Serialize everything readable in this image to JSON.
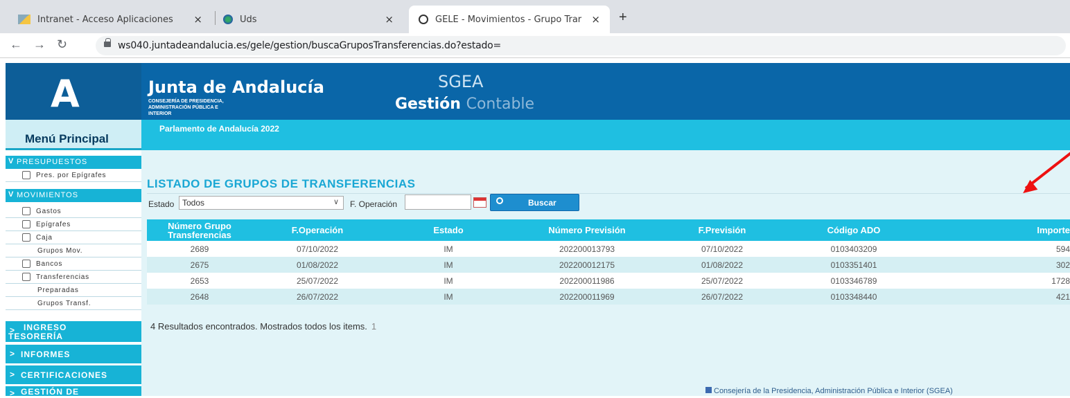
{
  "browser": {
    "tabs": [
      {
        "title": "Intranet - Acceso Aplicaciones",
        "close": "×"
      },
      {
        "title": "Uds",
        "close": "×"
      },
      {
        "title": "GELE - Movimientos - Grupo Trar",
        "close": "×"
      }
    ],
    "new_tab": "+",
    "url": "ws040.juntadeandalucia.es/gele/gestion/buscaGruposTransferencias.do?estado="
  },
  "header": {
    "logo_letter": "A",
    "org": "Junta de Andalucía",
    "consejeria": "CONSEJERÍA DE PRESIDENCIA, ADMINISTRACIÓN PÚBLICA E INTERIOR",
    "app": "SGEA",
    "subtitle_a": "Gestión",
    "subtitle_b": "Contable"
  },
  "menu": {
    "title": "Menú Principal",
    "presupuestos": "PRESUPUESTOS",
    "pres_epigrafes": "Pres. por Epígrafes",
    "movimientos": "MOVIMIENTOS",
    "gastos": "Gastos",
    "epigrafes": "Epígrafes",
    "caja": "Caja",
    "grupos_mov": "Grupos Mov.",
    "bancos": "Bancos",
    "transferencias": "Transferencias",
    "preparadas": "Preparadas",
    "grupos_transf": "Grupos Transf.",
    "ingreso": "INGRESO",
    "tesoreria": "TESORERÍA",
    "informes": "INFORMES",
    "certificaciones": "CERTIFICACIONES",
    "gestion_de": "GESTIÓN DE"
  },
  "context": "Parlamento de Andalucía 2022",
  "page_title": "LISTADO DE GRUPOS DE TRANSFERENCIAS",
  "filters": {
    "estado_label": "Estado",
    "estado_value": "Todos",
    "fecha_label": "F. Operación",
    "fecha_value": "",
    "buscar": "Buscar"
  },
  "table": {
    "headers": [
      "Número Grupo Transferencias",
      "F.Operación",
      "Estado",
      "Número Previsión",
      "F.Previsión",
      "Código ADO",
      "Importe"
    ],
    "rows": [
      [
        "2689",
        "07/10/2022",
        "IM",
        "202200013793",
        "07/10/2022",
        "0103403209",
        "594"
      ],
      [
        "2675",
        "01/08/2022",
        "IM",
        "202200012175",
        "01/08/2022",
        "0103351401",
        "302"
      ],
      [
        "2653",
        "25/07/2022",
        "IM",
        "202200011986",
        "25/07/2022",
        "0103346789",
        "1728"
      ],
      [
        "2648",
        "26/07/2022",
        "IM",
        "202200011969",
        "26/07/2022",
        "0103348440",
        "421"
      ]
    ]
  },
  "results": {
    "text": "4 Resultados encontrados. Mostrados todos los items.",
    "page": "1"
  },
  "footer": "Consejería de la Presidencia, Administración Pública e Interior (SGEA)"
}
